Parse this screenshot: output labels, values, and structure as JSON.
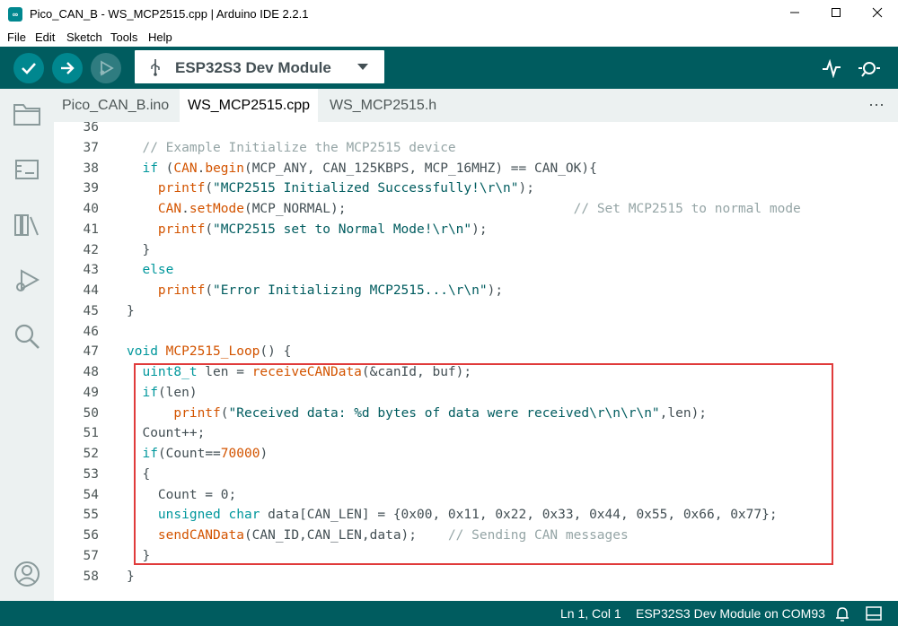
{
  "window": {
    "title": "Pico_CAN_B - WS_MCP2515.cpp | Arduino IDE 2.2.1",
    "app_icon_text": "∞"
  },
  "menu": [
    "File",
    "Edit",
    "Sketch",
    "Tools",
    "Help"
  ],
  "toolbar": {
    "board": "ESP32S3 Dev Module",
    "buttons": [
      "verify-icon",
      "upload-icon",
      "debug-icon"
    ]
  },
  "tabs": [
    {
      "label": "Pico_CAN_B.ino",
      "active": false
    },
    {
      "label": "WS_MCP2515.cpp",
      "active": true
    },
    {
      "label": "WS_MCP2515.h",
      "active": false
    }
  ],
  "tab_more": "⋯",
  "code": [
    {
      "n": "36",
      "t": ""
    },
    {
      "n": "37",
      "t": "  // Example Initialize the MCP2515 device"
    },
    {
      "n": "38",
      "t": "  if (CAN.begin(MCP_ANY, CAN_125KBPS, MCP_16MHZ) == CAN_OK){"
    },
    {
      "n": "39",
      "t": "    printf(\"MCP2515 Initialized Successfully!\\r\\n\");"
    },
    {
      "n": "40",
      "t": "    CAN.setMode(MCP_NORMAL);                             // Set MCP2515 to normal mode"
    },
    {
      "n": "41",
      "t": "    printf(\"MCP2515 set to Normal Mode!\\r\\n\");"
    },
    {
      "n": "42",
      "t": "  }"
    },
    {
      "n": "43",
      "t": "  else"
    },
    {
      "n": "44",
      "t": "    printf(\"Error Initializing MCP2515...\\r\\n\");"
    },
    {
      "n": "45",
      "t": "}"
    },
    {
      "n": "46",
      "t": ""
    },
    {
      "n": "47",
      "t": "void MCP2515_Loop() {"
    },
    {
      "n": "48",
      "t": "  uint8_t len = receiveCANData(&canId, buf);"
    },
    {
      "n": "49",
      "t": "  if(len)"
    },
    {
      "n": "50",
      "t": "      printf(\"Received data: %d bytes of data were received\\r\\n\\r\\n\",len);"
    },
    {
      "n": "51",
      "t": "  Count++;"
    },
    {
      "n": "52",
      "t": "  if(Count==70000)"
    },
    {
      "n": "53",
      "t": "  {"
    },
    {
      "n": "54",
      "t": "    Count = 0;"
    },
    {
      "n": "55",
      "t": "    unsigned char data[CAN_LEN] = {0x00, 0x11, 0x22, 0x33, 0x44, 0x55, 0x66, 0x77};"
    },
    {
      "n": "56",
      "t": "    sendCANData(CAN_ID,CAN_LEN,data);    // Sending CAN messages"
    },
    {
      "n": "57",
      "t": "  }"
    },
    {
      "n": "58",
      "t": "}"
    }
  ],
  "status": {
    "position": "Ln 1, Col 1",
    "board_port": "ESP32S3 Dev Module on COM93"
  },
  "colors": {
    "toolbar": "#005c5f",
    "button": "#00878f",
    "highlight": "#e03b3b"
  }
}
